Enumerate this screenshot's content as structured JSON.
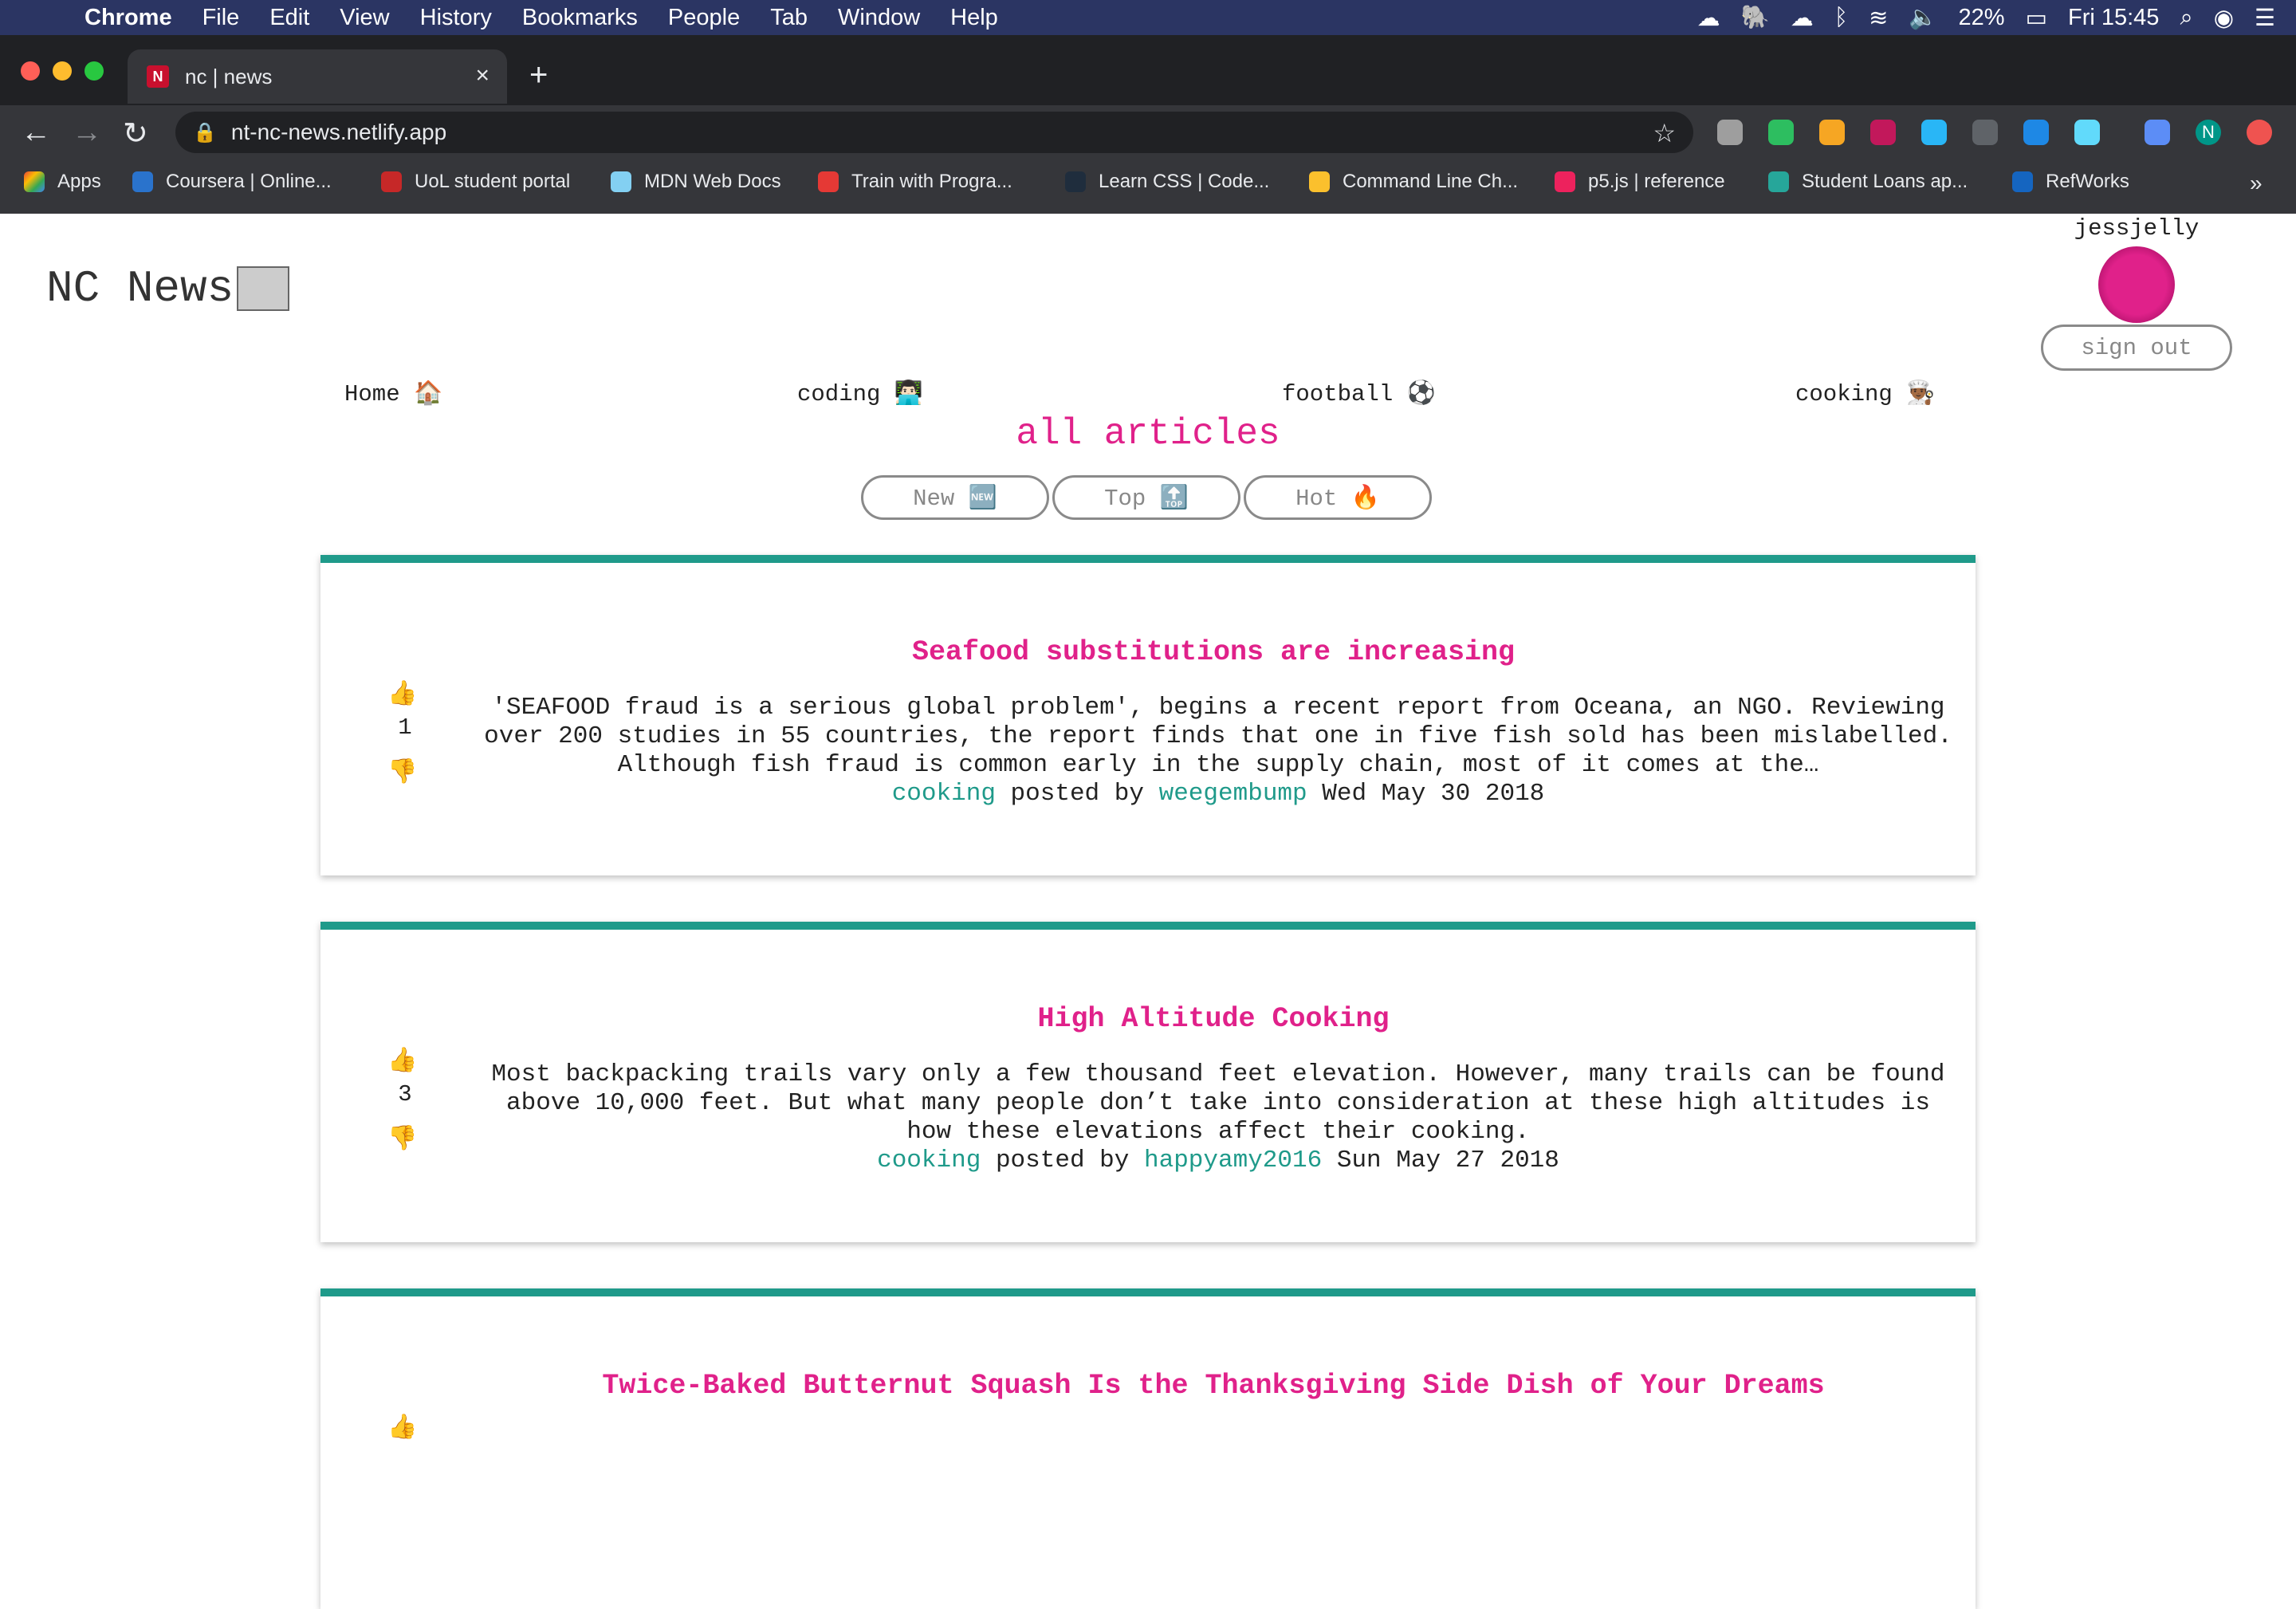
{
  "menubar": {
    "app": "Chrome",
    "items": [
      "File",
      "Edit",
      "View",
      "History",
      "Bookmarks",
      "People",
      "Tab",
      "Window",
      "Help"
    ],
    "battery": "22%",
    "clock": "Fri 15:45"
  },
  "browser": {
    "tab_title": "nc | news",
    "url": "nt-nc-news.netlify.app",
    "bookmarks": [
      "Apps",
      "Coursera | Online...",
      "UoL student portal",
      "MDN Web Docs",
      "Train with Progra...",
      "Learn CSS | Code...",
      "Command Line Ch...",
      "p5.js | reference",
      "Student Loans ap...",
      "RefWorks"
    ],
    "bookmarks_overflow": "»",
    "profile_initial": "N"
  },
  "site": {
    "title": "NC News",
    "username": "jessjelly",
    "signout_label": "sign out",
    "topics": [
      "Home 🏠",
      "coding 👨🏻‍💻",
      "football ⚽",
      "cooking 👨🏾‍🍳"
    ],
    "section_title": "all articles",
    "sort": [
      "New 🆕",
      "Top 🔝",
      "Hot 🔥"
    ]
  },
  "articles": [
    {
      "title": "Seafood substitutions are increasing",
      "votes": "1",
      "body": "'SEAFOOD fraud is a serious global problem', begins a recent report from Oceana, an NGO. Reviewing over 200 studies in 55 countries, the report finds that one in five fish sold has been mislabelled. Although fish fraud is common early in the supply chain, most of it comes at the…",
      "topic": "cooking",
      "posted_by": "posted by",
      "author": "weegembump",
      "date": "Wed May 30 2018"
    },
    {
      "title": "High Altitude Cooking",
      "votes": "3",
      "body": "Most backpacking trails vary only a few thousand feet elevation. However, many trails can be found above 10,000 feet. But what many people don’t take into consideration at these high altitudes is how these elevations affect their cooking.",
      "topic": "cooking",
      "posted_by": "posted by",
      "author": "happyamy2016",
      "date": "Sun May 27 2018"
    },
    {
      "title": "Twice-Baked Butternut Squash Is the Thanksgiving Side Dish of Your Dreams"
    }
  ],
  "icons": {
    "upvote": "👍",
    "downvote": "👎"
  }
}
